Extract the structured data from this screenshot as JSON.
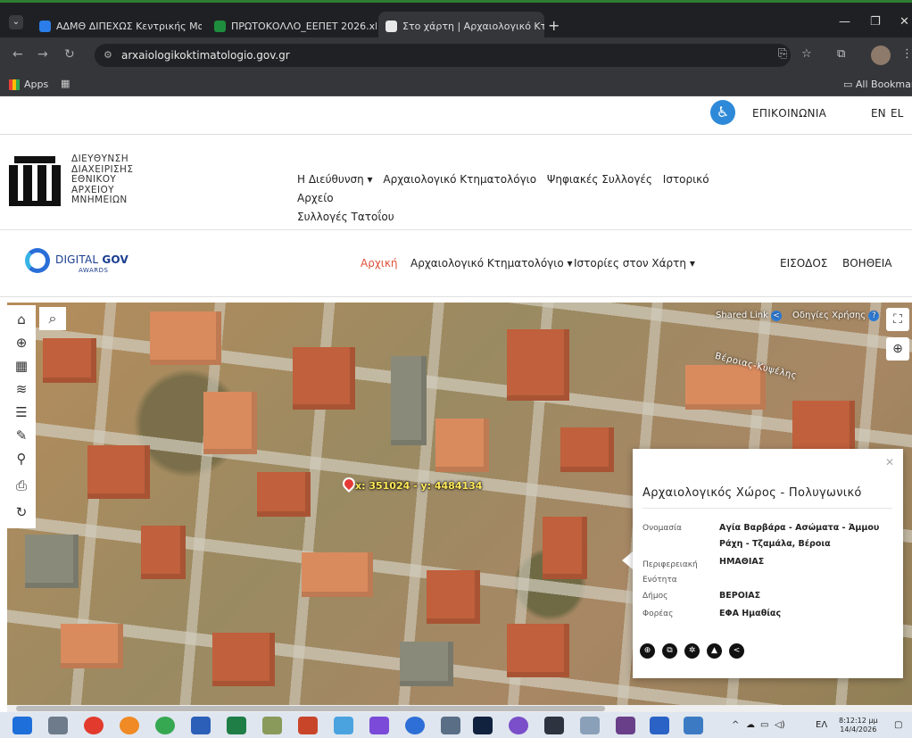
{
  "browser": {
    "tabs": [
      {
        "label": "ΑΔΜΘ ΔΙΠΕΧΩΣ Κεντρικής Μα",
        "active": false
      },
      {
        "label": "ΠΡΩΤΟΚΟΛΛΟ_ΕΕΠΕΤ 2026.xls",
        "active": false
      },
      {
        "label": "Στο χάρτη | Αρχαιολογικό Κτη",
        "active": true
      }
    ],
    "new_tab": "+",
    "url": "arxaiologikoktimatologio.gov.gr",
    "bookmarks": {
      "apps": "Apps",
      "all": "All Bookmarks"
    }
  },
  "site_top": {
    "contact": "ΕΠΙΚΟΙΝΩΝΙΑ",
    "lang_en": "EN",
    "lang_el": "EL"
  },
  "ministry": {
    "org_name": "ΔΙΕΥΘΥΝΣΗ\nΔΙΑΧΕΙΡΙΣΗΣ\nΕΘΝΙΚΟΥ\nΑΡΧΕΙΟΥ\nΜΝΗΜΕΙΩΝ",
    "nav": [
      "Η Διεύθυνση ▾",
      "Αρχαιολογικό Κτηματολόγιο",
      "Ψηφιακές Συλλογές",
      "Ιστορικό Αρχείο",
      "Συλλογές Τατοΐου"
    ]
  },
  "sitenav": {
    "logo_main": "DIGITAL",
    "logo_bold": "GOV",
    "logo_sub": "AWARDS",
    "home": "Αρχική",
    "items": [
      "Αρχαιολογικό Κτηματολόγιο ▾",
      "Ιστορίες στον Χάρτη ▾",
      "ΕΙΣΟΔΟΣ",
      "ΒΟΗΘΕΙΑ"
    ]
  },
  "map": {
    "shared_link": "Shared Link",
    "guide": "Οδηγίες Χρήσης",
    "street": "Βέροιας-Κυψέλης",
    "coords": "x: 351024 - y: 4484134",
    "popup": {
      "title": "Αρχαιολογικός Χώρος - Πολυγωνικό",
      "rows": [
        {
          "label": "Ονομασία",
          "value": "Αγία Βαρβάρα - Ασώματα - Άμμου Ράχη - Τζαμάλα, Βέροια"
        },
        {
          "label": "Περιφερειακή Ενότητα",
          "value": "ΗΜΑΘΙΑΣ"
        },
        {
          "label": "Δήμος",
          "value": "ΒΕΡΟΙΑΣ"
        },
        {
          "label": "Φορέας",
          "value": "ΕΦΑ Ημαθίας"
        }
      ]
    }
  },
  "taskbar": {
    "lang": "ΕΛ",
    "time": "8:12:12 μμ",
    "date": "14/4/2026"
  },
  "colors": {
    "accent": "#e0523a",
    "brand_blue": "#2a6fd8",
    "pin": "#e53935"
  }
}
